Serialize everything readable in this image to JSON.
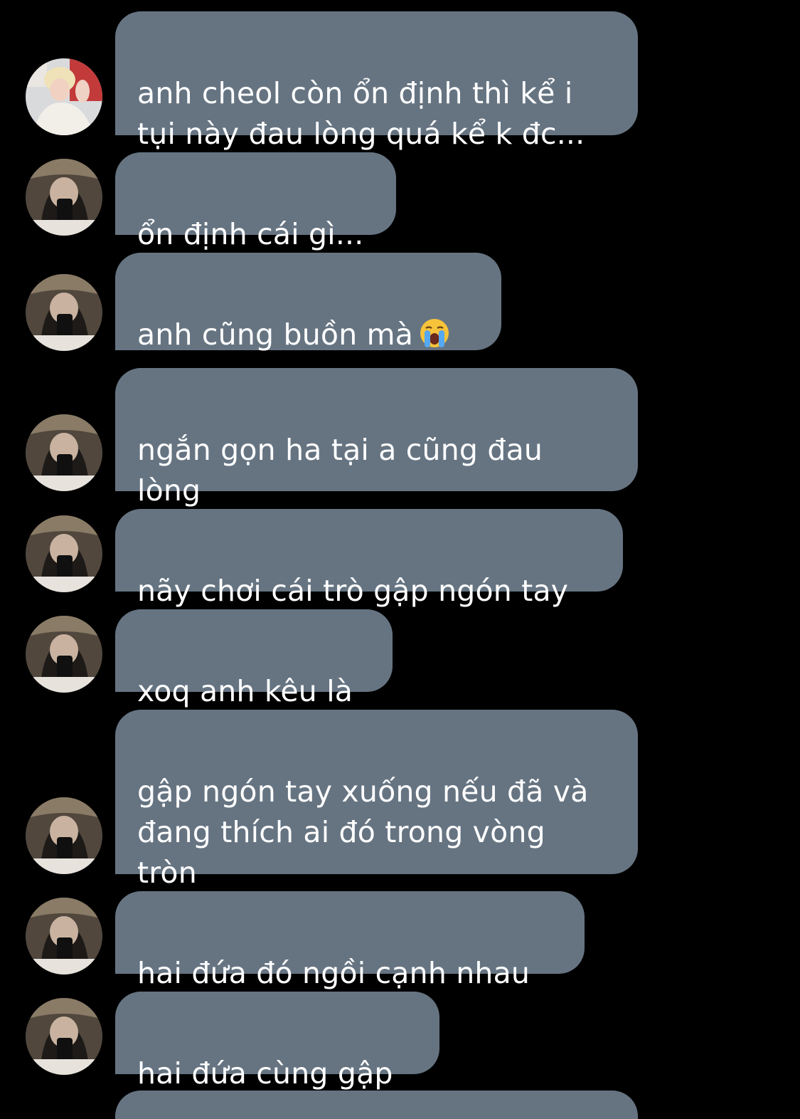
{
  "messages": [
    {
      "text": "anh cheol còn ổn định thì kể i\ntụi này đau lòng quá kể k đc...",
      "sender": "friend",
      "emoji": ""
    },
    {
      "text": "ổn định cái gì...",
      "sender": "anh",
      "emoji": ""
    },
    {
      "text": "anh cũng buồn mà",
      "sender": "anh",
      "emoji": "loudly-crying-face"
    },
    {
      "text": "ngắn gọn ha tại a cũng đau\nlòng",
      "sender": "anh",
      "emoji": ""
    },
    {
      "text": "nãy chơi cái trò gập ngón tay",
      "sender": "anh",
      "emoji": ""
    },
    {
      "text": "xoq anh kêu là",
      "sender": "anh",
      "emoji": ""
    },
    {
      "text": "gập ngón tay xuống nếu đã và\nđang thích ai đó trong vòng\ntròn",
      "sender": "anh",
      "emoji": ""
    },
    {
      "text": "hai đứa đó ngồi cạnh nhau",
      "sender": "anh",
      "emoji": ""
    },
    {
      "text": "hai đứa cùng gập",
      "sender": "anh",
      "emoji": ""
    }
  ],
  "colors": {
    "background": "#000000",
    "bubble": "#667482",
    "text": "#ffffff"
  }
}
